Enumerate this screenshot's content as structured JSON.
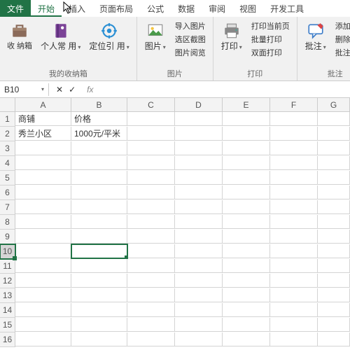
{
  "tabs": {
    "file": "文件",
    "home": "开始",
    "insert": "插入",
    "layout": "页面布局",
    "formula": "公式",
    "data": "数据",
    "review": "审阅",
    "view": "视图",
    "dev": "开发工具"
  },
  "ribbon": {
    "g1": {
      "btn1": "收\n纳箱",
      "btn2": "个人常\n用",
      "btn3": "定位引\n用",
      "label": "我的收纳箱"
    },
    "g2": {
      "btn": "图片",
      "l1": "导入图片",
      "l2": "选区截图",
      "l3": "图片阅览",
      "label": "图片"
    },
    "g3": {
      "btn": "打印",
      "l1": "打印当前页",
      "l2": "批量打印",
      "l3": "双面打印",
      "label": "打印"
    },
    "g4": {
      "btn": "批注",
      "l1": "添加批注",
      "l2": "删除批注",
      "l3": "批注阅览",
      "label": "批注"
    }
  },
  "namebox": "B10",
  "colHeaders": [
    "A",
    "B",
    "C",
    "D",
    "E",
    "F",
    "G"
  ],
  "rows": 16,
  "cells": {
    "A1": "商铺",
    "B1": "价格",
    "A2": "秀兰小区",
    "B2": "1000元/平米"
  },
  "selected": "B10"
}
